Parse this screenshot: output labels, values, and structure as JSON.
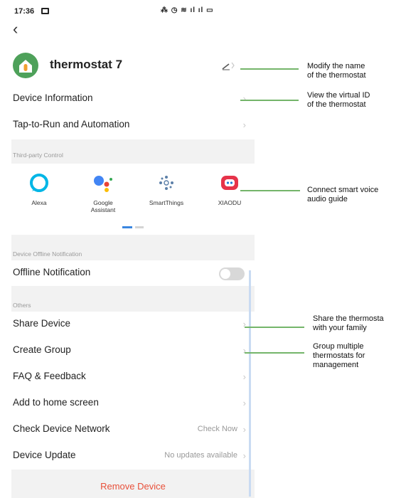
{
  "status_bar": {
    "time": "17:36",
    "icons": "⁂ ◷ ≋ ıl ıl ▭"
  },
  "device": {
    "name": "thermostat 7"
  },
  "rows": {
    "device_information": "Device Information",
    "tap_to_run": "Tap-to-Run and Automation",
    "offline_notification": "Offline Notification",
    "share_device": "Share Device",
    "create_group": "Create Group",
    "faq_feedback": "FAQ & Feedback",
    "add_home_screen": "Add to home screen",
    "check_network": "Check Device Network",
    "check_network_value": "Check Now",
    "device_update": "Device Update",
    "device_update_value": "No updates available"
  },
  "sections": {
    "third_party": "Third-party Control",
    "offline": "Device Offline Notification",
    "others": "Others"
  },
  "third_party": {
    "alexa": "Alexa",
    "google_line1": "Google",
    "google_line2": "Assistant",
    "smartthings": "SmartThings",
    "xiaodu": "XIAODU"
  },
  "offline_toggle_on": false,
  "remove_device": "Remove Device",
  "annotations": {
    "modify_name_1": "Modify the name",
    "modify_name_2": "of the thermostat",
    "virtual_id_1": "View the virtual ID",
    "virtual_id_2": "of the thermostat",
    "voice_1": "Connect smart voice",
    "voice_2": "audio guide",
    "share_1": "Share the thermosta",
    "share_2": "with your family",
    "group_1": "Group multiple",
    "group_2": "thermostats for",
    "group_3": "management"
  },
  "colors": {
    "accent_blue": "#3a86e0",
    "remove_red": "#e8503a",
    "annotation_green": "#74b56a",
    "device_icon_green": "#4ea15a"
  }
}
